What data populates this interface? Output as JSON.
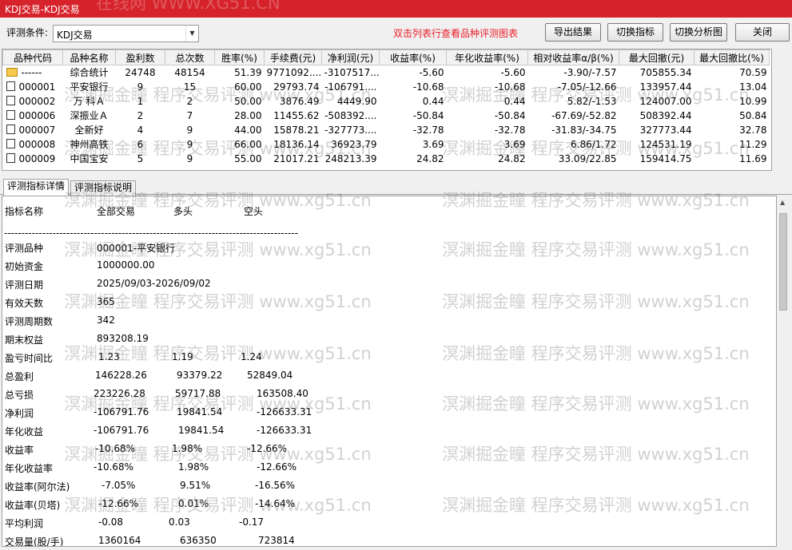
{
  "window": {
    "title": "KDJ交易-KDJ交易"
  },
  "toolbar": {
    "condition_label": "评测条件:",
    "condition_value": "KDJ交易",
    "hint": "双击列表行查看品种评测图表",
    "export_label": "导出结果",
    "switch_indicator_label": "切换指标",
    "switch_chart_label": "切换分析图",
    "close_label": "关闭"
  },
  "grid": {
    "columns": [
      "品种代码",
      "品种名称",
      "盈利数",
      "总次数",
      "胜率(%)",
      "手续费(元)",
      "净利润(元)",
      "收益率(%)",
      "年化收益率(%)",
      "相对收益率α/β(%)",
      "最大回撤(元)",
      "最大回撤比(%)"
    ],
    "rows": [
      [
        "------",
        "综合统计",
        "24748",
        "48154",
        "51.39",
        "9771092....",
        "-3107517....",
        "-5.60",
        "-5.60",
        "-3.90/-7.57",
        "705855.34",
        "70.59"
      ],
      [
        "000001",
        "平安银行",
        "9",
        "15",
        "60.00",
        "29793.74",
        "-106791....",
        "-10.68",
        "-10.68",
        "-7.05/-12.66",
        "133957.44",
        "13.04"
      ],
      [
        "000002",
        "万 科Ａ",
        "1",
        "2",
        "50.00",
        "3876.49",
        "4449.90",
        "0.44",
        "0.44",
        "5.82/-1.53",
        "124007.00",
        "10.99"
      ],
      [
        "000006",
        "深振业Ａ",
        "2",
        "7",
        "28.00",
        "11455.62",
        "-508392....",
        "-50.84",
        "-50.84",
        "-67.69/-52.82",
        "508392.44",
        "50.84"
      ],
      [
        "000007",
        "全新好",
        "4",
        "9",
        "44.00",
        "15878.21",
        "-327773....",
        "-32.78",
        "-32.78",
        "-31.83/-34.75",
        "327773.44",
        "32.78"
      ],
      [
        "000008",
        "神州高铁",
        "6",
        "9",
        "66.00",
        "18136.14",
        "36923.79",
        "3.69",
        "3.69",
        "6.86/1.72",
        "124531.19",
        "11.29"
      ],
      [
        "000009",
        "中国宝安",
        "5",
        "9",
        "55.00",
        "21017.21",
        "248213.39",
        "24.82",
        "24.82",
        "33.09/22.85",
        "159414.75",
        "11.69"
      ]
    ]
  },
  "tabs": [
    "评测指标详情",
    "评测指标说明"
  ],
  "detail": {
    "headers": [
      "指标名称",
      "全部交易",
      "多头",
      "空头"
    ],
    "separator": "-------------------------------------------------------------------------------------",
    "info": [
      {
        "label": "评测品种",
        "value": "000001-平安银行"
      },
      {
        "label": "初始资金",
        "value": "1000000.00"
      },
      {
        "label": "评测日期",
        "value": "2025/09/03-2026/09/02"
      },
      {
        "label": "有效天数",
        "value": "365"
      },
      {
        "label": "评测周期数",
        "value": "342"
      },
      {
        "label": "期末权益",
        "value": "893208.19"
      }
    ],
    "metrics": [
      {
        "label": "盈亏时间比",
        "all": "1.23",
        "long": "1.19",
        "short": "1.24"
      },
      {
        "label": "总盈利",
        "all": "146228.26",
        "long": "93379.22",
        "short": "52849.04"
      },
      {
        "label": "总亏损",
        "all": "223226.28",
        "long": "59717.88",
        "short": "163508.40"
      },
      {
        "label": "净利润",
        "all": "-106791.76",
        "long": "19841.54",
        "short": "-126633.31"
      },
      {
        "label": "年化收益",
        "all": "-106791.76",
        "long": "19841.54",
        "short": "-126633.31"
      },
      {
        "label": "收益率",
        "all": "-10.68%",
        "long": "1.98%",
        "short": "-12.66%"
      },
      {
        "label": "年化收益率",
        "all": "-10.68%",
        "long": "1.98%",
        "short": "-12.66%"
      },
      {
        "label": "收益率(阿尔法)",
        "all": "-7.05%",
        "long": "9.51%",
        "short": "-16.56%"
      },
      {
        "label": "收益率(贝塔)",
        "all": "-12.66%",
        "long": "0.01%",
        "short": "-14.64%"
      },
      {
        "label": "平均利润",
        "all": "-0.08",
        "long": "0.03",
        "short": "-0.17"
      },
      {
        "label": "交易量(股/手)",
        "all": "1360164",
        "long": "636350",
        "short": "723814"
      }
    ]
  },
  "watermark": {
    "text": "溟渊掘金瞳 程序交易评测 www.xg51.cn",
    "top_text": "在线网 WWW.XG51.CN"
  },
  "colors": {
    "titlebar": "#d6222a",
    "hint": "#e8202a"
  }
}
